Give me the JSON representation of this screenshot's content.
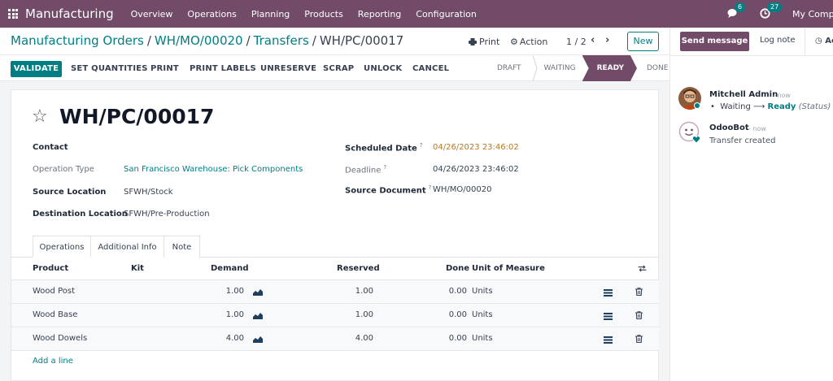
{
  "navbar": {
    "app_name": "Manufacturing",
    "menu": [
      "Overview",
      "Operations",
      "Planning",
      "Products",
      "Reporting",
      "Configuration"
    ],
    "messages_count": "6",
    "activities_count": "27",
    "company": "My Company"
  },
  "breadcrumb": [
    "Manufacturing Orders",
    "WH/MO/00020",
    "Transfers",
    "WH/PC/00017"
  ],
  "control": {
    "print_label": "Print",
    "action_label": "Action",
    "pager": "1 / 2",
    "new_label": "New"
  },
  "statusbar": {
    "buttons": [
      "VALIDATE",
      "SET QUANTITIES",
      "PRINT",
      "PRINT LABELS",
      "UNRESERVE",
      "SCRAP",
      "UNLOCK",
      "CANCEL"
    ],
    "stages": [
      "DRAFT",
      "WAITING",
      "READY",
      "DONE"
    ],
    "active_stage": "READY"
  },
  "record": {
    "title": "WH/PC/00017",
    "contact_label": "Contact",
    "operation_type_label": "Operation Type",
    "operation_type_value": "San Francisco Warehouse: Pick Components",
    "source_location_label": "Source Location",
    "source_location_value": "SFWH/Stock",
    "destination_location_label": "Destination Location",
    "destination_location_value": "SFWH/Pre-Production",
    "scheduled_date_label": "Scheduled Date",
    "scheduled_date_value": "04/26/2023 23:46:02",
    "deadline_label": "Deadline",
    "deadline_value": "04/26/2023 23:46:02",
    "source_document_label": "Source Document",
    "source_document_value": "WH/MO/00020",
    "help_mark": "?"
  },
  "tabs": [
    "Operations",
    "Additional Info",
    "Note"
  ],
  "table": {
    "headers": [
      "Product",
      "Kit",
      "Demand",
      "Reserved",
      "Done",
      "Unit of Measure"
    ],
    "rows": [
      {
        "product": "Wood Post",
        "demand": "1.00",
        "reserved": "1.00",
        "done": "0.00",
        "uom": "Units"
      },
      {
        "product": "Wood Base",
        "demand": "1.00",
        "reserved": "1.00",
        "done": "0.00",
        "uom": "Units"
      },
      {
        "product": "Wood Dowels",
        "demand": "4.00",
        "reserved": "4.00",
        "done": "0.00",
        "uom": "Units"
      }
    ],
    "add_line": "Add a line"
  },
  "chatter": {
    "send_message": "Send message",
    "log_note": "Log note",
    "activities": "Activities",
    "messages": [
      {
        "author": "Mitchell Admin",
        "date": "- now",
        "old_value": "Waiting",
        "new_value": "Ready",
        "field": "(Status)"
      },
      {
        "author": "OdooBot",
        "date": "- now",
        "body": "Transfer created"
      }
    ]
  },
  "colors": {
    "brand": "#714b67",
    "accent": "#017e84",
    "warning_date": "#b7791f"
  }
}
